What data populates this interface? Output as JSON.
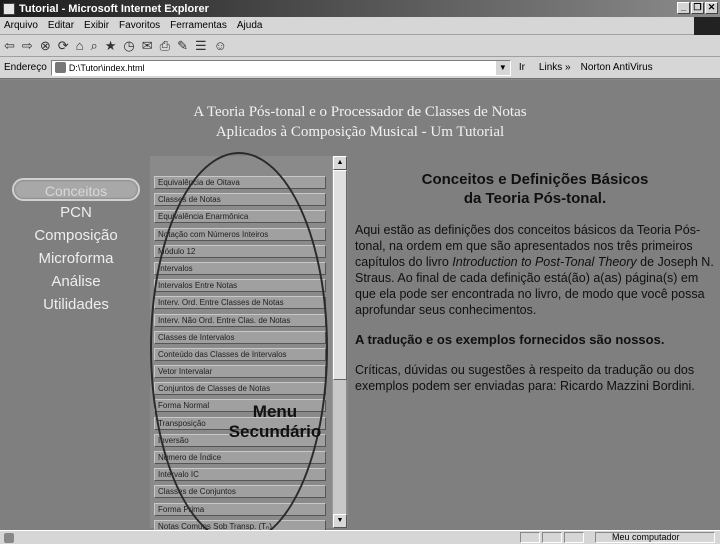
{
  "window": {
    "title": "Tutorial - Microsoft Internet Explorer",
    "buttons": [
      "_",
      "❐",
      "✕"
    ]
  },
  "menubar": [
    "Arquivo",
    "Editar",
    "Exibir",
    "Favoritos",
    "Ferramentas",
    "Ajuda"
  ],
  "address": {
    "label": "Endereço",
    "value": "D:\\Tutor\\index.html",
    "go": "Ir",
    "links": "Links »",
    "norton": "Norton AntiVirus"
  },
  "page": {
    "title_line1": "A Teoria Pós-tonal e o Processador de Classes de Notas",
    "title_line2": "Aplicados à Composição Musical - Um Tutorial"
  },
  "main_menu": [
    "Conceitos",
    "PCN",
    "Composição",
    "Microforma",
    "Análise",
    "Utilidades"
  ],
  "secondary_menu": [
    "Equivalência de Oitava",
    "Classes de Notas",
    "Equivalência Enarmônica",
    "Notação com Números Inteiros",
    "Módulo 12",
    "Intervalos",
    "Intervalos Entre Notas",
    "Interv. Ord. Entre Classes de Notas",
    "Interv. Não Ord. Entre Clas. de Notas",
    "Classes de Intervalos",
    "Conteúdo das Classes de Intervalos",
    "Vetor Intervalar",
    "Conjuntos de Classes de Notas",
    "Forma Normal",
    "Transposição",
    "Inversão",
    "Número de Índice",
    "Intervalo IC",
    "Classes de Conjuntos",
    "Forma Prima",
    "Notas Comuns Sob Transp. (Tₙ)"
  ],
  "annotation": {
    "line1": "Menu",
    "line2": "Secundário"
  },
  "content": {
    "heading_line1": "Conceitos e Definições Básicos",
    "heading_line2": "da Teoria Pós-tonal.",
    "para1_a": "Aqui estão as definições dos conceitos básicos da Teoria Pós-tonal, na ordem em que são apresentados nos três primeiros capítulos do livro ",
    "para1_book": "Introduction to Post-Tonal Theory",
    "para1_b": " de Joseph N. Straus. Ao final de cada definição está(ão) a(as) página(s) em que ela pode ser encontrada no livro, de modo que você possa aprofundar seus conhecimentos.",
    "para2": "A tradução e os exemplos fornecidos são nossos.",
    "para3": "Críticas, dúvidas ou sugestões à respeito da tradução ou dos exemplos podem ser enviadas para: Ricardo Mazzini Bordini."
  },
  "statusbar": {
    "zone": "Meu computador"
  }
}
